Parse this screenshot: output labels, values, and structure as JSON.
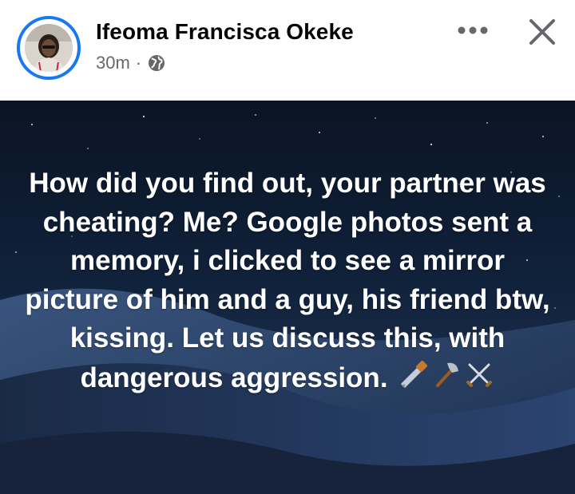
{
  "post": {
    "author_name": "Ifeoma Francisca Okeke",
    "time": "30m",
    "separator": "·",
    "privacy_icon": "globe-icon",
    "more_icon": "more-horizontal-icon",
    "close_icon": "close-icon",
    "text": "How did you find out, your partner was cheating? Me? Google photos sent a memory, i clicked to see a mirror picture of him and a guy, his friend btw, kissing. Let us discuss this, with dangerous aggression.",
    "emojis": [
      "saw-icon",
      "axe-icon",
      "crossed-swords-icon"
    ]
  },
  "colors": {
    "accent": "#1877f2",
    "name_text": "#050505",
    "meta_text": "#65676b",
    "background_top": "#0a1424",
    "background_bottom": "#243a5e",
    "post_text": "#ffffff"
  }
}
